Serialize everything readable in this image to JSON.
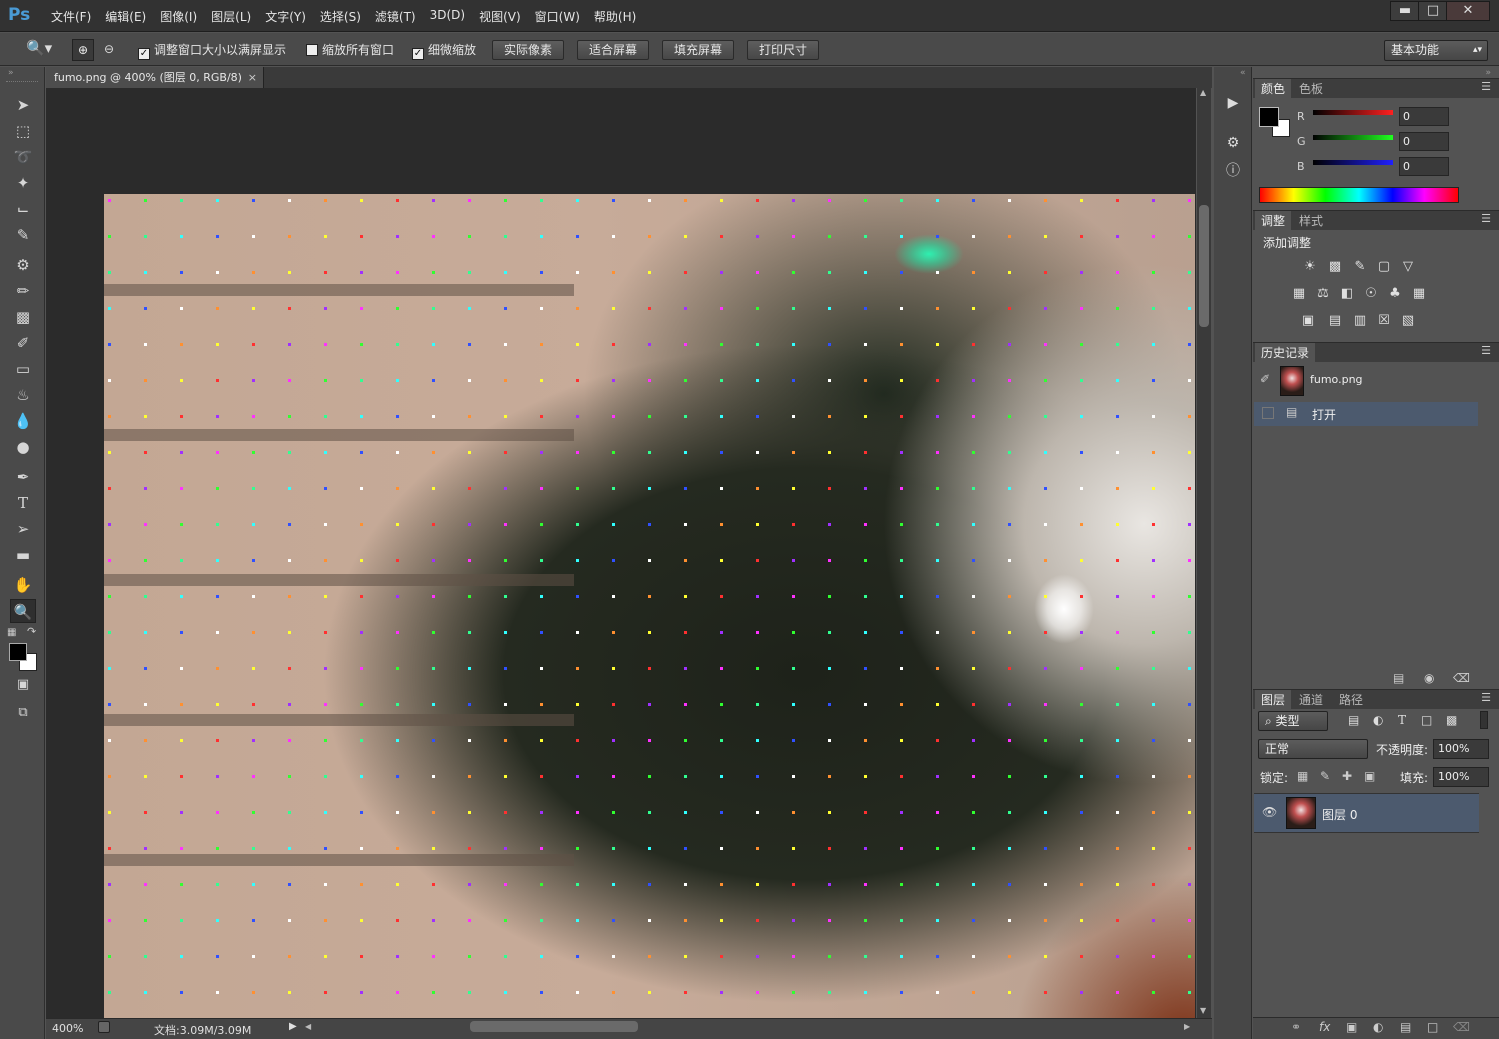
{
  "app": {
    "logo": "Ps",
    "menus": [
      "文件(F)",
      "编辑(E)",
      "图像(I)",
      "图层(L)",
      "文字(Y)",
      "选择(S)",
      "滤镜(T)",
      "3D(D)",
      "视图(V)",
      "窗口(W)",
      "帮助(H)"
    ],
    "window_controls": {
      "minimize": "▬",
      "maximize": "□",
      "close": "✕"
    }
  },
  "options": {
    "tool_icon": "zoom-icon",
    "checkboxes": [
      {
        "label": "调整窗口大小以满屏显示",
        "checked": true
      },
      {
        "label": "缩放所有窗口",
        "checked": false
      },
      {
        "label": "细微缩放",
        "checked": true
      }
    ],
    "buttons": [
      "实际像素",
      "适合屏幕",
      "填充屏幕",
      "打印尺寸"
    ],
    "workspace": "基本功能"
  },
  "document": {
    "tab_title": "fumo.png @ 400% (图层 0, RGB/8)",
    "close_glyph": "×"
  },
  "status": {
    "zoom": "400%",
    "doc_info": "文档:3.09M/3.09M"
  },
  "tools": [
    "move-tool",
    "marquee-tool",
    "lasso-tool",
    "magic-wand-tool",
    "crop-tool",
    "eyedropper-tool",
    "healing-brush-tool",
    "brush-tool",
    "clone-stamp-tool",
    "history-brush-tool",
    "eraser-tool",
    "paint-bucket-tool",
    "blur-tool",
    "dodge-tool",
    "pen-tool",
    "type-tool",
    "path-selection-tool",
    "rectangle-tool",
    "hand-tool",
    "zoom-tool"
  ],
  "color_panel": {
    "tabs": [
      "颜色",
      "色板"
    ],
    "channels": [
      {
        "label": "R",
        "value": "0",
        "color": "#e02020"
      },
      {
        "label": "G",
        "value": "0",
        "color": "#20c020"
      },
      {
        "label": "B",
        "value": "0",
        "color": "#2020e0"
      }
    ]
  },
  "adjustments_panel": {
    "tabs": [
      "调整",
      "样式"
    ],
    "title": "添加调整"
  },
  "history_panel": {
    "tabs": [
      "历史记录"
    ],
    "snapshot": "fumo.png",
    "steps": [
      "打开"
    ]
  },
  "layers_panel": {
    "tabs": [
      "图层",
      "通道",
      "路径"
    ],
    "filter_kind": "类型",
    "blend_mode": "正常",
    "opacity_label": "不透明度:",
    "opacity": "100%",
    "lock_label": "锁定:",
    "fill_label": "填充:",
    "fill": "100%",
    "layers": [
      {
        "name": "图层 0",
        "visible": true
      }
    ]
  },
  "colors": {
    "accent": "#4a9bd6",
    "selected_row": "#4c5a6e"
  }
}
